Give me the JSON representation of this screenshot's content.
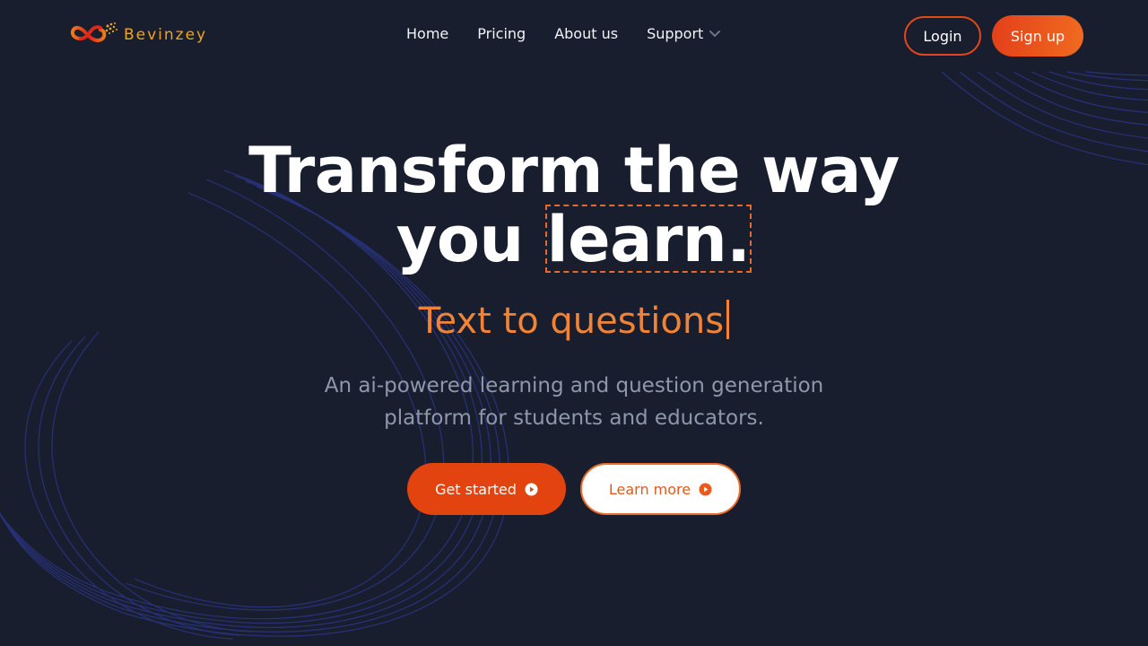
{
  "brand": {
    "name": "Bevinzey",
    "logo_icon": "infinity-logo-icon"
  },
  "nav": {
    "links": [
      {
        "label": "Home"
      },
      {
        "label": "Pricing"
      },
      {
        "label": "About us"
      },
      {
        "label": "Support",
        "icon": "chevron-down-icon"
      }
    ],
    "login_label": "Login",
    "signup_label": "Sign up"
  },
  "hero": {
    "headline_line1": "Transform the way",
    "headline_line2_prefix": "you",
    "headline_highlight": "learn.",
    "typing_text": "Text to questions",
    "subtitle": "An ai-powered learning and question generation platform for students and educators.",
    "primary_cta": "Get started",
    "secondary_cta": "Learn more"
  },
  "colors": {
    "background": "#181e2e",
    "accent": "#e4401a",
    "accent_light": "#f08336",
    "logo_text": "#f0a41f",
    "subtitle": "#8f98ab",
    "wave_lines": "#2b3585"
  }
}
